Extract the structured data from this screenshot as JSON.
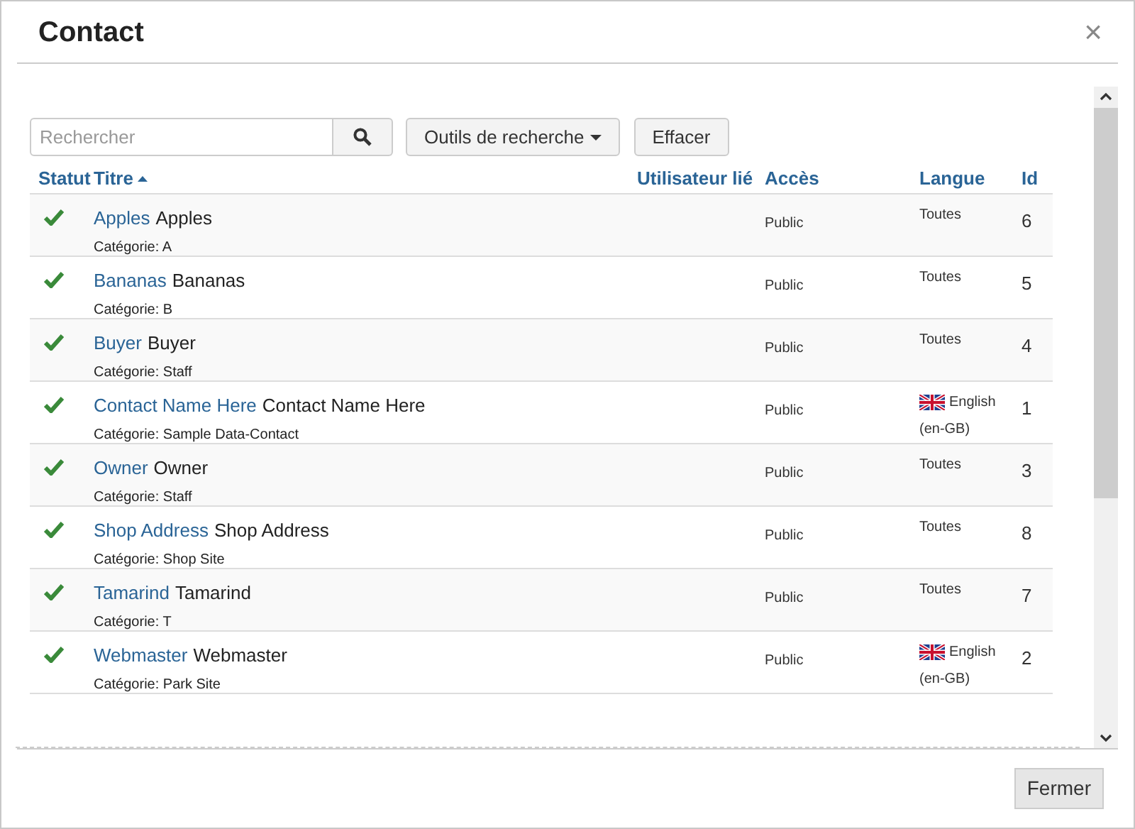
{
  "window": {
    "title": "Contact",
    "close": "×"
  },
  "toolbar": {
    "search": {
      "placeholder": "Rechercher"
    },
    "tools_button": "Outils de recherche",
    "clear_button": "Effacer"
  },
  "table": {
    "columns": [
      "Statut",
      "Titre",
      "Utilisateur lié",
      "Accès",
      "Langue",
      "Id"
    ],
    "rows": [
      {
        "published": true,
        "link": "Apples",
        "title": "Apples",
        "category": "Catégorie: A",
        "access": "Public",
        "language": {
          "kind": "text",
          "label": "Toutes"
        },
        "id": "6"
      },
      {
        "published": true,
        "link": "Bananas",
        "title": "Bananas",
        "category": "Catégorie: B",
        "access": "Public",
        "language": {
          "kind": "text",
          "label": "Toutes"
        },
        "id": "5"
      },
      {
        "published": true,
        "link": "Buyer",
        "title": "Buyer",
        "category": "Catégorie: Staff",
        "access": "Public",
        "language": {
          "kind": "text",
          "label": "Toutes"
        },
        "id": "4"
      },
      {
        "published": true,
        "link": "Contact Name Here",
        "title": "Contact Name Here",
        "category": "Catégorie: Sample Data-Contact",
        "access": "Public",
        "language": {
          "kind": "flag",
          "label": "English",
          "code": "(en-GB)"
        },
        "id": "1"
      },
      {
        "published": true,
        "link": "Owner",
        "title": "Owner",
        "category": "Catégorie: Staff",
        "access": "Public",
        "language": {
          "kind": "text",
          "label": "Toutes"
        },
        "id": "3"
      },
      {
        "published": true,
        "link": "Shop Address",
        "title": "Shop Address",
        "category": "Catégorie: Shop Site",
        "access": "Public",
        "language": {
          "kind": "text",
          "label": "Toutes"
        },
        "id": "8"
      },
      {
        "published": true,
        "link": "Tamarind",
        "title": "Tamarind",
        "category": "Catégorie: T",
        "access": "Public",
        "language": {
          "kind": "text",
          "label": "Toutes"
        },
        "id": "7"
      },
      {
        "published": true,
        "link": "Webmaster",
        "title": "Webmaster",
        "category": "Catégorie: Park Site",
        "access": "Public",
        "language": {
          "kind": "flag",
          "label": "English",
          "code": "(en-GB)"
        },
        "id": "2"
      }
    ]
  },
  "footer": {
    "close_button": "Fermer"
  }
}
